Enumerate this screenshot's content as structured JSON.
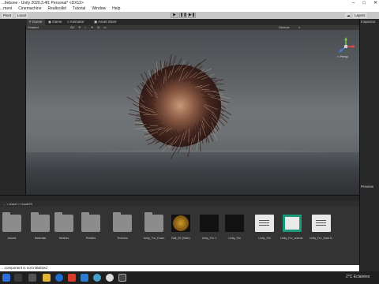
{
  "window": {
    "title": "...llebone - Unity 2020.3.4f1 Personal* <DX12>",
    "controls": [
      "–",
      "□",
      "✕"
    ]
  },
  "menu": [
    "...ment",
    "Cinemachine",
    "Realtoolkit",
    "Tutorial",
    "Window",
    "Help"
  ],
  "toolbar": {
    "pivot": "Pivot",
    "local": "Local",
    "layers": "Layers",
    "layout": "Layout"
  },
  "editor_tabs": [
    "Scene",
    "Game",
    "Animator",
    "Asset Store"
  ],
  "scene_toolbar": {
    "shading": "Shaded",
    "view_2d": "2D",
    "gizmos": "Gizmos"
  },
  "gizmo": {
    "label": "< Persp"
  },
  "right_panel": {
    "inspector": "Inspector",
    "preview": "Preview"
  },
  "project": {
    "breadcrumb": "... > Asset > hoodOS"
  },
  "assets": [
    {
      "label": "Assets",
      "type": "folder"
    },
    {
      "label": "Materials",
      "type": "folder"
    },
    {
      "label": "Meshes",
      "type": "folder"
    },
    {
      "label": "Prefabs",
      "type": "folder"
    },
    {
      "label": "Textures",
      "type": "folder"
    },
    {
      "label": "Unity_Fur_Exam",
      "type": "folder"
    },
    {
      "label": "Ball_02 (Mate)",
      "type": "ball"
    },
    {
      "label": "Unity_Fur 1",
      "type": "dark"
    },
    {
      "label": "Unity_Shi",
      "type": "dark"
    },
    {
      "label": "Unity_Shi",
      "type": "doc"
    },
    {
      "label": "Unity_Fur_animat...",
      "type": "graph"
    },
    {
      "label": "Unity_Fur_Data 6...",
      "type": "doc"
    }
  ],
  "status": {
    "message": "...component is not initialized"
  },
  "taskbar": {
    "clock": "2°C  Eclairées"
  },
  "colors": {
    "editor_bg": "#282828",
    "toolbar": "#c8c8c8",
    "accent": "#3a79c4"
  }
}
